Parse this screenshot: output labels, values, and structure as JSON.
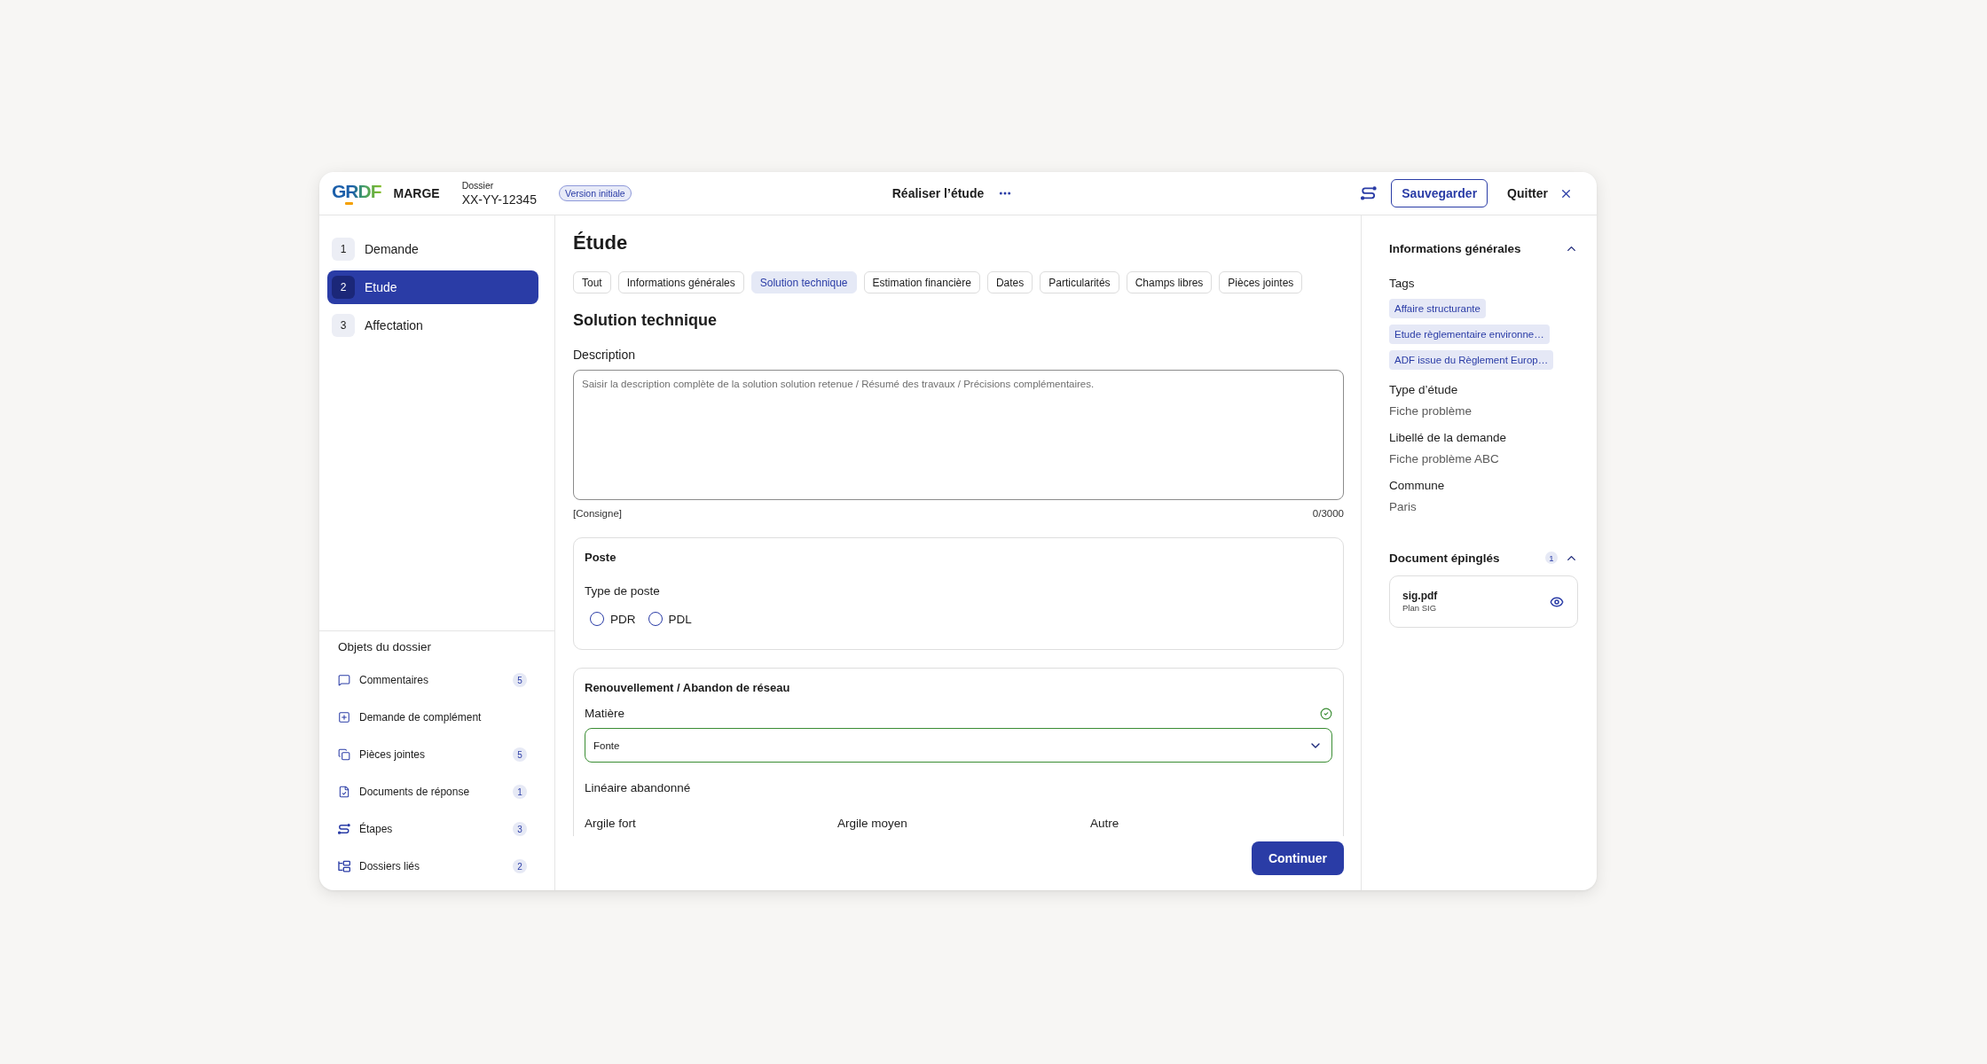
{
  "header": {
    "logo": "GRDF",
    "app_name": "MARGE",
    "dossier_label": "Dossier",
    "dossier_number": "XX-YY-12345",
    "version_badge": "Version initiale",
    "task_title": "Réaliser l’étude",
    "save_button": "Sauvegarder",
    "quit_button": "Quitter"
  },
  "steps": [
    {
      "number": "1",
      "label": "Demande",
      "selected": false
    },
    {
      "number": "2",
      "label": "Etude",
      "selected": true
    },
    {
      "number": "3",
      "label": "Affectation",
      "selected": false
    }
  ],
  "objects": {
    "title": "Objets du dossier",
    "items": [
      {
        "label": "Commentaires",
        "count": "5"
      },
      {
        "label": "Demande de complément"
      },
      {
        "label": "Pièces jointes",
        "count": "5"
      },
      {
        "label": "Documents de réponse",
        "count": "1"
      },
      {
        "label": "Étapes",
        "count": "3"
      },
      {
        "label": "Dossiers liés",
        "count": "2"
      }
    ]
  },
  "main": {
    "title": "Étude",
    "tabs": [
      {
        "label": "Tout",
        "selected": false
      },
      {
        "label": "Informations générales",
        "selected": false
      },
      {
        "label": "Solution technique",
        "selected": true
      },
      {
        "label": "Estimation financière",
        "selected": false
      },
      {
        "label": "Dates",
        "selected": false
      },
      {
        "label": "Particularités",
        "selected": false
      },
      {
        "label": "Champs libres",
        "selected": false
      },
      {
        "label": "Pièces jointes",
        "selected": false
      }
    ],
    "section_title": "Solution technique",
    "description": {
      "label": "Description",
      "placeholder": "Saisir la description complète de la solution solution retenue / Résumé des travaux / Précisions complémentaires.",
      "hint": "[Consigne]",
      "counter": "0/3000"
    },
    "cards": [
      {
        "title": "Poste",
        "fields": [
          {
            "kind": "radio",
            "label": "Type de poste",
            "options": [
              {
                "label": "PDR",
                "selected": false
              },
              {
                "label": "PDL",
                "selected": false
              }
            ]
          }
        ]
      },
      {
        "title": "Renouvellement / Abandon de réseau",
        "fields": [
          {
            "kind": "select",
            "label": "Matière",
            "value": "Fonte",
            "valid": true
          },
          {
            "kind": "columns",
            "label": "Linéaire abandonné",
            "columns": [
              "Argile fort",
              "Argile moyen",
              "Autre"
            ]
          }
        ]
      }
    ],
    "continue_button": "Continuer"
  },
  "info_panel": {
    "sections": [
      {
        "kind": "info",
        "title": "Informations générales",
        "expanded": true,
        "tags_label": "Tags",
        "tags": [
          "Affaire structurante",
          "Etude règlementaire environne…",
          "ADF issue du Règlement Europ…"
        ],
        "fields": [
          {
            "label": "Type d’étude",
            "value": "Fiche problème"
          },
          {
            "label": "Libellé de la demande",
            "value": "Fiche problème ABC"
          },
          {
            "label": "Commune",
            "value": "Paris"
          }
        ]
      },
      {
        "kind": "documents",
        "title": "Document épinglés",
        "count": "1",
        "expanded": true,
        "documents": [
          {
            "name": "sig.pdf",
            "description": "Plan SIG"
          }
        ]
      }
    ]
  }
}
